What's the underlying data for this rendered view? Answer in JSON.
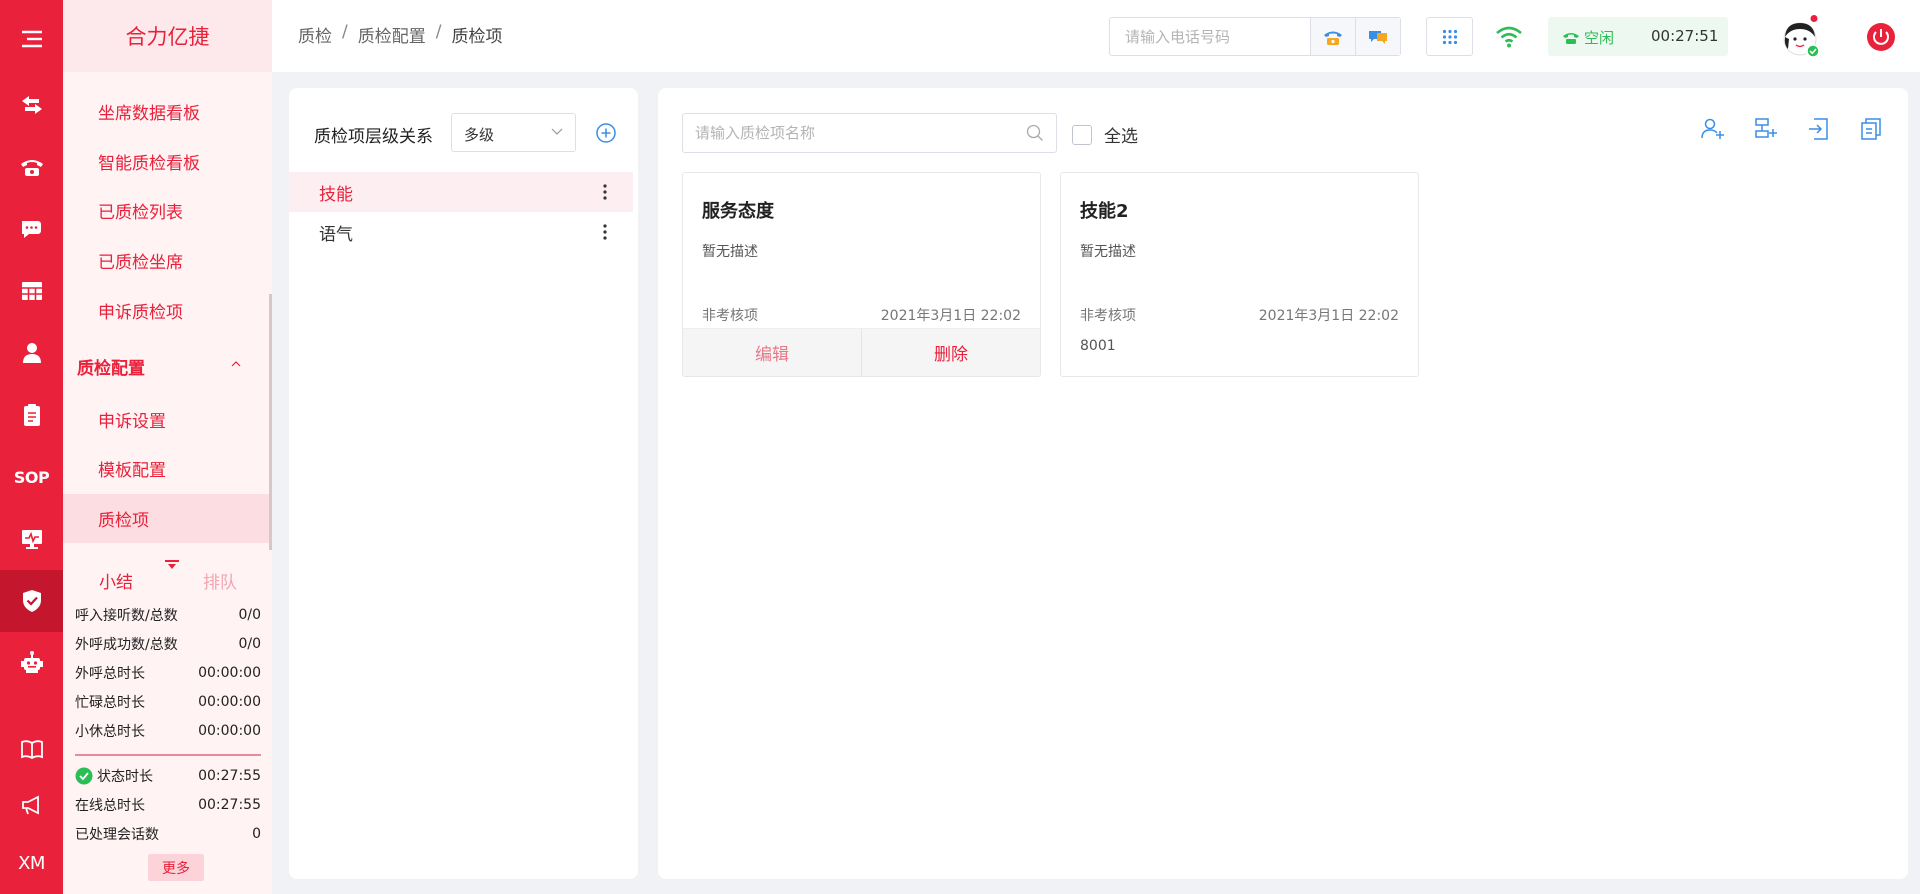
{
  "app": {
    "brand": "合力亿捷"
  },
  "rail": {
    "items": [
      "menu",
      "transfer",
      "phone",
      "chat",
      "table",
      "user",
      "clipboard",
      "SOP",
      "monitor",
      "quality",
      "robot",
      "book",
      "announce",
      "XM"
    ],
    "sop_label": "SOP",
    "xm_label": "XM"
  },
  "submenu": {
    "items_top": [
      "坐席数据看板",
      "智能质检看板",
      "已质检列表",
      "已质检坐席",
      "申诉质检项"
    ],
    "group": "质检配置",
    "group_items": [
      "申诉设置",
      "模板配置",
      "质检项"
    ],
    "active": "质检项"
  },
  "stats": {
    "tab_summary": "小结",
    "tab_queue": "排队",
    "rows_a": [
      {
        "label": "呼入接听数/总数",
        "value": "0/0"
      },
      {
        "label": "外呼成功数/总数",
        "value": "0/0"
      },
      {
        "label": "外呼总时长",
        "value": "00:00:00"
      },
      {
        "label": "忙碌总时长",
        "value": "00:00:00"
      },
      {
        "label": "小休总时长",
        "value": "00:00:00"
      }
    ],
    "rows_b": [
      {
        "label": "状态时长",
        "value": "00:27:55"
      },
      {
        "label": "在线总时长",
        "value": "00:27:55"
      },
      {
        "label": "已处理会话数",
        "value": "0"
      }
    ],
    "more": "更多"
  },
  "header": {
    "breadcrumb": [
      "质检",
      "质检配置",
      "质检项"
    ],
    "breadcrumb_sep": "/",
    "phone_placeholder": "请输入电话号码",
    "status": "空闲",
    "timer": "00:27:51"
  },
  "tree": {
    "title": "质检项层级关系",
    "select_value": "多级",
    "items": [
      "技能",
      "语气"
    ],
    "selected": "技能"
  },
  "main": {
    "search_placeholder": "请输入质检项名称",
    "select_all": "全选",
    "cards": [
      {
        "title": "服务态度",
        "desc": "暂无描述",
        "type": "非考核项",
        "date": "2021年3月1日 22:02",
        "edit": "编辑",
        "delete": "删除"
      },
      {
        "title": "技能2",
        "desc": "暂无描述",
        "type": "非考核项",
        "date": "2021年3月1日 22:02",
        "code": "8001"
      }
    ]
  },
  "colors": {
    "brand_red": "#e9213a",
    "rail_active": "#c4162d",
    "status_green": "#2cbd56",
    "link_blue": "#3a8ee6"
  }
}
